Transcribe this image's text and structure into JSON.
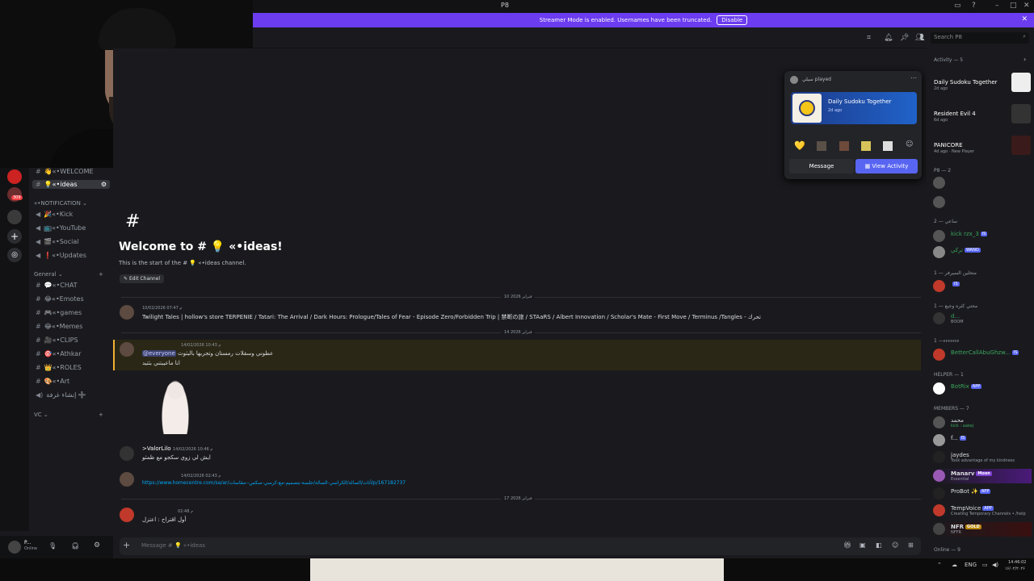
{
  "window": {
    "title": "P8"
  },
  "banner": {
    "text": "Streamer Mode is enabled. Usernames have been truncated.",
    "button": "Disable"
  },
  "search": {
    "placeholder": "Search P8"
  },
  "guilds": {
    "notif_count": "309"
  },
  "channels": {
    "top": [
      {
        "label": "👋«•WELCOME"
      },
      {
        "label": "💡«•ideas"
      }
    ],
    "notification_category": "«•NOTIFICATION",
    "notification": [
      {
        "label": "🎉«•Kick"
      },
      {
        "label": "📺«•YouTube"
      },
      {
        "label": "🎬«•Social"
      },
      {
        "label": "❗«•Updates"
      }
    ],
    "general_category": "General",
    "general": [
      {
        "label": "💬«•CHAT"
      },
      {
        "label": "😂«•Emotes"
      },
      {
        "label": "🎮«•games"
      },
      {
        "label": "😂«•Memes"
      },
      {
        "label": "🎥«•CLIPS"
      },
      {
        "label": "🎯«•Athkar"
      },
      {
        "label": "👑«•ROLES"
      },
      {
        "label": "🎨«•Art"
      },
      {
        "label": "إنشاء غرفة ➕"
      }
    ],
    "vc_category": "VC"
  },
  "user": {
    "name": "P...",
    "status": "Online"
  },
  "chat": {
    "welcome_title": "Welcome to # 💡 «•ideas!",
    "welcome_sub": "This is the start of the # 💡 «•ideas channel.",
    "edit_channel": "Edit Channel",
    "messages": [
      {
        "date": "10 فبراير 2026",
        "time": "10/02/2026 07:47 م",
        "text": "Twilight Tales | hollow's store TERPENIE / Tatari: The Arrival / Dark Hours: Prologue/Tales of Fear - Episode Zero/Forbidden Trip | 禁断の旅 / STAaRS / Albert Innovation / Scholar's Mate - First Move / Terminus /Tangles - تحرك"
      },
      {
        "date": "14 فبراير 2026",
        "time": "14/02/2026 10:43 م",
        "mention": "@everyone",
        "text": "عطوني وسقلات رمستان وتجربها بالبثوث",
        "text2": "انا ماعيبتني بثتيد"
      },
      {
        "name": ">ValorLilo",
        "time": "14/02/2026 10:46 م",
        "text": "ايش لي زوي سكجو مع ظمثو"
      },
      {
        "time": "14/02/2026 02:43 م",
        "link": "https://www.homecentre.com/sa/ar/أثاث/الصالة/الكراسي-الصالة/جلسة-بتصميم-مع-كرسي-سكس--مقاسات/p/167182737"
      },
      {
        "date": "17 فبراير 2026",
        "time": "02:48 م",
        "text": "أول اقتراح : اعتزل"
      }
    ],
    "composer_placeholder": "Message # 💡 «•ideas"
  },
  "popup": {
    "user_played": "سيلي played",
    "game": "Daily Sudoku Together",
    "game_time": "2d ago",
    "message_button": "Message",
    "view_button": "View Activity"
  },
  "members": {
    "activity_header": "Activity — 5",
    "activities": [
      {
        "game": "Daily Sudoku Together",
        "sub": "2d ago"
      },
      {
        "game": "Resident Evil 4",
        "sub": "6d ago"
      },
      {
        "game": "PANICORE",
        "sub": "4d ago · New Player"
      }
    ],
    "sections": [
      {
        "title": "P8 — 2"
      },
      {
        "title": "ساعي — 2"
      },
      {
        "title": "متخلين السيرفر — 1"
      },
      {
        "title": "محتي كثره وجيع — 1"
      },
      {
        "title": "ءءءءءءء— 1"
      },
      {
        "title": "HELPER — 1"
      },
      {
        "title": "MEMBERS — 7"
      },
      {
        "title": "Online — 9"
      }
    ],
    "rows": [
      {
        "name": "kick rzx_3",
        "badge": "IS",
        "color": "#3ba55d"
      },
      {
        "name": "تركي",
        "badge": "WANO",
        "color": "#3ba55d"
      },
      {
        "name": "",
        "badge": "IS",
        "color": "#c33"
      },
      {
        "name": "d...",
        "sub": "BOOM",
        "color": "#3ba55d"
      },
      {
        "name": "BetterCallAbuGhzw...",
        "badge": "IS",
        "color": "#3ba55d"
      },
      {
        "name": "BotRix",
        "badge": "APP",
        "color": "#3ba55d"
      },
      {
        "name": "محمد",
        "sub": "kick : aakej",
        "color": "#dbdee1"
      },
      {
        "name": "f...",
        "badge": "IS",
        "color": "#dbdee1"
      },
      {
        "name": "jaydes",
        "sub": "Took advantage of my kindness",
        "color": "#dbdee1"
      },
      {
        "name": "Manarv",
        "badge": "Moon",
        "sub": "Essential",
        "color": "#dbdee1"
      },
      {
        "name": "ProBot ✨",
        "badge": "APP",
        "color": "#dbdee1"
      },
      {
        "name": "TempVoice",
        "badge": "APP",
        "sub": "Creating Temporary Channels • /help",
        "color": "#dbdee1"
      },
      {
        "name": "NFR",
        "badge": "GOLD",
        "sub": "NFFR",
        "color": "#dbdee1"
      }
    ]
  },
  "taskbar": {
    "lang": "ENG",
    "time": "14:46:02",
    "date": "۱۶/۰۲/۲۰۲۶"
  }
}
